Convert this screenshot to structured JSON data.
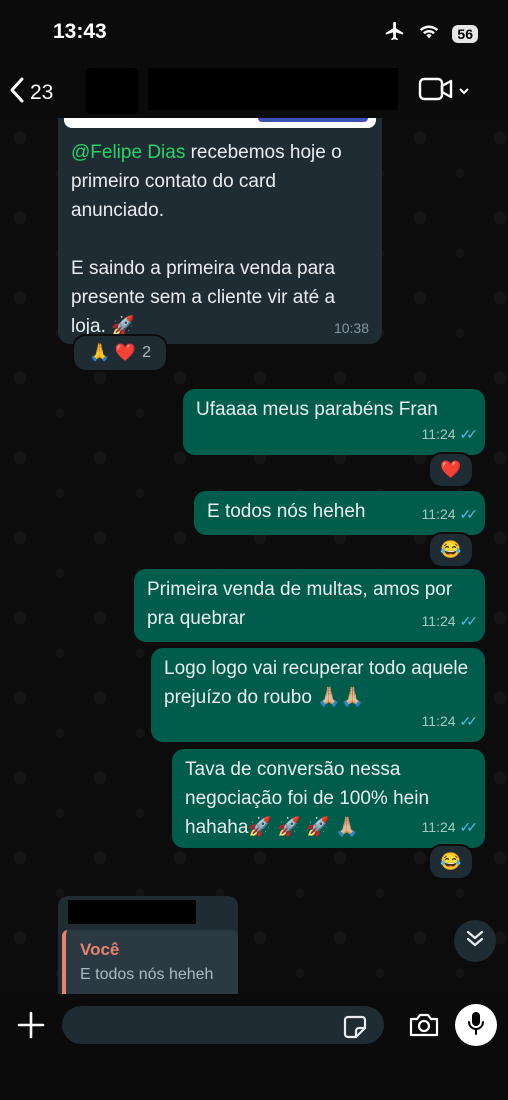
{
  "status_bar": {
    "time": "13:43",
    "battery": "56"
  },
  "header": {
    "back_count": "23"
  },
  "incoming": {
    "mention": "@Felipe Dias",
    "text_after_mention": " recebemos hoje o primeiro contato do card anunciado.",
    "paragraph2": "E saindo a primeira venda para presente sem a cliente vir até a loja. 🚀",
    "time": "10:38",
    "reaction_emojis": "🙏 ❤️",
    "reaction_count": "2"
  },
  "outgoing": [
    {
      "text": "Ufaaaa meus parabéns Fran",
      "time": "11:24",
      "reaction": "❤️"
    },
    {
      "text": "E todos nós heheh",
      "time": "11:24",
      "reaction": "😂"
    },
    {
      "text": "Primeira venda de multas,  amos por pra quebrar",
      "time": "11:24",
      "reaction": ""
    },
    {
      "text": "Logo logo vai recuperar todo aquele prejuízo do roubo 🙏🏼🙏🏼",
      "time": "11:24",
      "reaction": ""
    },
    {
      "text": "Tava de conversão nessa negociação foi de 100% hein hahaha🚀 🚀 🚀 🙏🏼",
      "time": "11:24",
      "reaction": "😂"
    }
  ],
  "reply_preview": {
    "name": "Você",
    "quote": "E todos nós heheh"
  },
  "icons": {
    "airplane": "airplane-icon",
    "wifi": "wifi-icon",
    "back": "chevron-left-icon",
    "video": "video-camera-icon",
    "scroll": "double-chevron-down-icon",
    "plus": "plus-icon",
    "sticker": "sticker-icon",
    "camera": "camera-icon",
    "mic": "microphone-icon"
  },
  "colors": {
    "outgoing_bubble": "#005c4b",
    "incoming_bubble": "#202c33",
    "read_ticks": "#53bdeb",
    "mention": "#25d366",
    "reply_accent": "#e8836d"
  }
}
